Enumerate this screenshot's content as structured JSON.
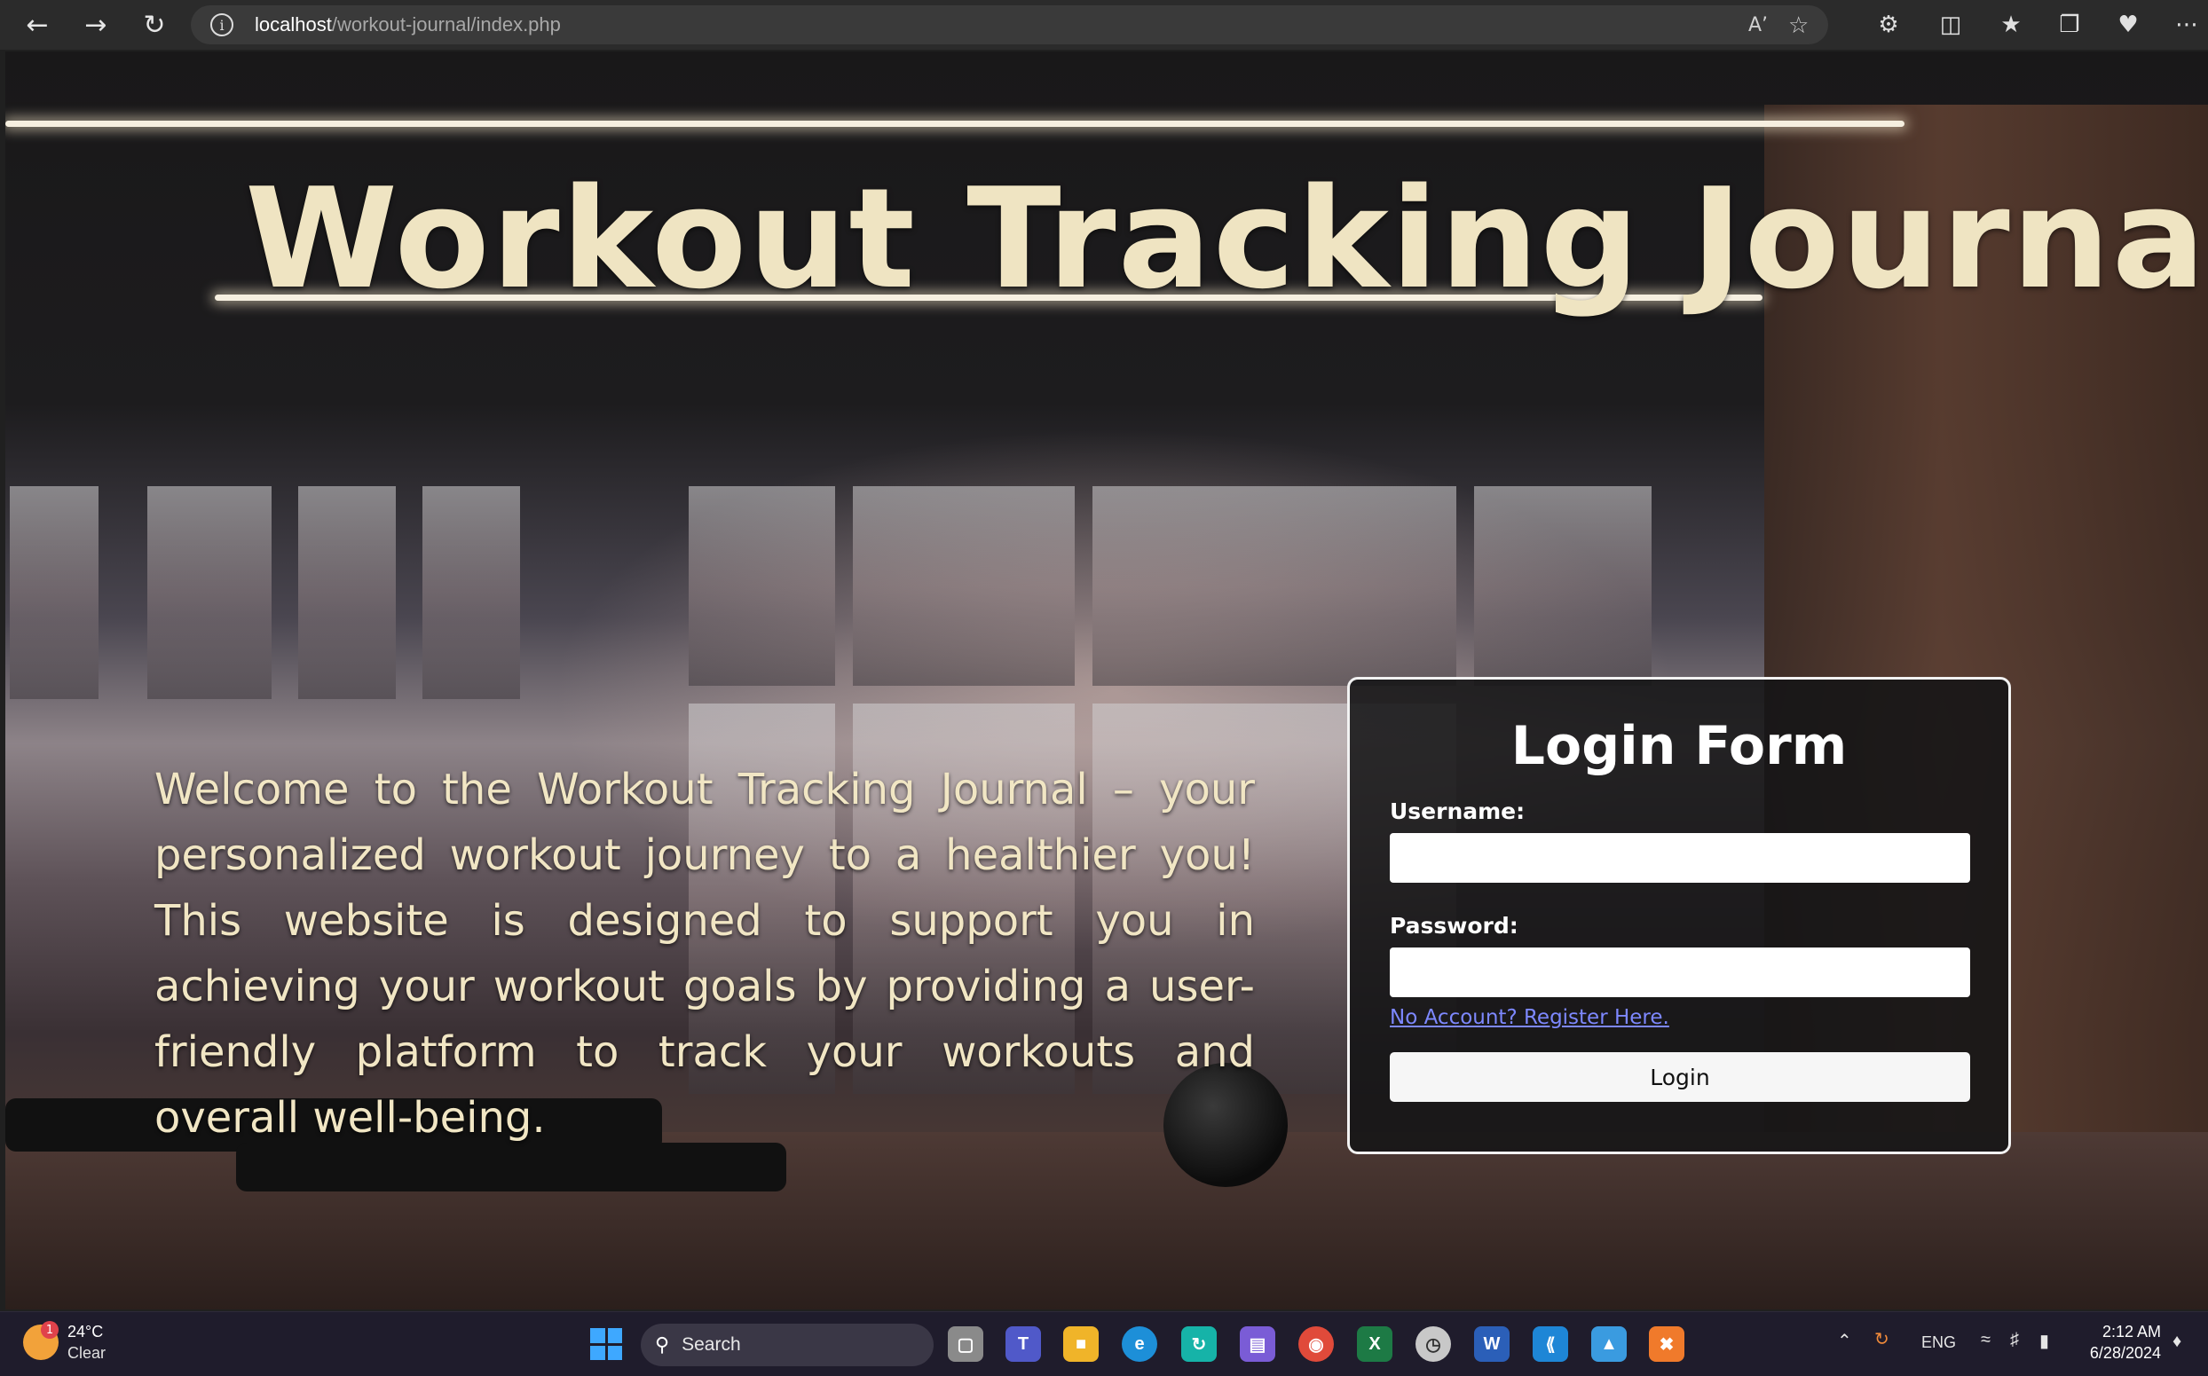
{
  "browser": {
    "url_host": "localhost",
    "url_path": "/workout-journal/index.php",
    "icons": [
      "back-icon",
      "forward-icon",
      "refresh-icon",
      "site-info-icon",
      "read-aloud-icon",
      "favorite-star-icon",
      "extensions-icon",
      "split-screen-icon",
      "favorites-icon",
      "collections-icon",
      "browser-essentials-icon",
      "more-icon"
    ]
  },
  "page": {
    "title": "Workout Tracking Journal",
    "intro": "Welcome to the Workout Tracking Journal – your personalized workout journey to a healthier you! This website is designed to support you in achieving your workout goals by providing a user-friendly platform to track your workouts and overall well-being."
  },
  "login": {
    "title": "Login Form",
    "username_label": "Username:",
    "username_value": "",
    "password_label": "Password:",
    "password_value": "",
    "register_link": "No Account? Register Here.",
    "submit_label": "Login"
  },
  "taskbar": {
    "weather_temp": "24°C",
    "weather_condition": "Clear",
    "weather_badge": "1",
    "search_label": "Search",
    "tray_language": "ENG",
    "clock_time": "2:12 AM",
    "clock_date": "6/28/2024",
    "apps": [
      "task-view",
      "teams",
      "file-explorer",
      "edge",
      "sync-app",
      "notes-app",
      "chrome",
      "excel",
      "clock-app",
      "word",
      "vscode",
      "azure-app",
      "xampp"
    ]
  },
  "colors": {
    "title": "#efe4c2",
    "link": "#7d88ff",
    "taskbar": "#1f1c2c"
  }
}
